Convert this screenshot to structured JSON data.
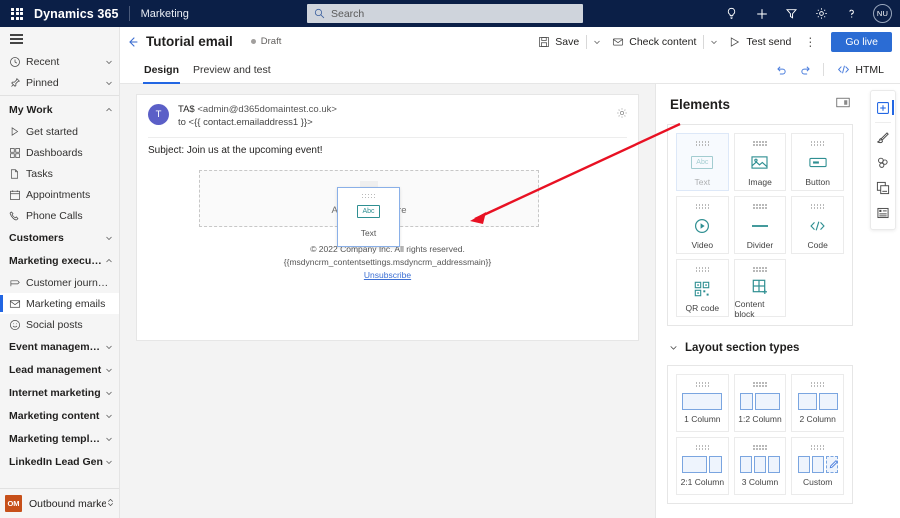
{
  "topnav": {
    "waffle_label": "app-launcher",
    "brand": "Dynamics 365",
    "app_name": "Marketing",
    "search_placeholder": "Search",
    "icons": [
      "lightbulb-icon",
      "plus-icon",
      "filter-icon",
      "gear-icon",
      "help-icon"
    ],
    "avatar_initials": "NU"
  },
  "sidebar": {
    "hamburger": "site-map-toggle",
    "items": [
      {
        "label": "Recent",
        "icon": "clock-icon",
        "type": "expandable",
        "chevron": "down"
      },
      {
        "label": "Pinned",
        "icon": "pin-icon",
        "type": "expandable",
        "chevron": "down"
      },
      {
        "label": "My Work",
        "icon": "",
        "type": "group",
        "chevron": "up"
      },
      {
        "label": "Get started",
        "icon": "play-icon",
        "type": "item"
      },
      {
        "label": "Dashboards",
        "icon": "dashboard-icon",
        "type": "item"
      },
      {
        "label": "Tasks",
        "icon": "task-icon",
        "type": "item"
      },
      {
        "label": "Appointments",
        "icon": "calendar-icon",
        "type": "item"
      },
      {
        "label": "Phone Calls",
        "icon": "phone-icon",
        "type": "item"
      },
      {
        "label": "Customers",
        "icon": "",
        "type": "group",
        "chevron": "down"
      },
      {
        "label": "Marketing execution",
        "icon": "",
        "type": "group",
        "chevron": "up"
      },
      {
        "label": "Customer journeys",
        "icon": "journey-icon",
        "type": "item"
      },
      {
        "label": "Marketing emails",
        "icon": "mail-icon",
        "type": "item",
        "selected": true
      },
      {
        "label": "Social posts",
        "icon": "social-icon",
        "type": "item"
      },
      {
        "label": "Event management",
        "icon": "",
        "type": "group",
        "chevron": "down"
      },
      {
        "label": "Lead management",
        "icon": "",
        "type": "group",
        "chevron": "down"
      },
      {
        "label": "Internet marketing",
        "icon": "",
        "type": "group",
        "chevron": "down"
      },
      {
        "label": "Marketing content",
        "icon": "",
        "type": "group",
        "chevron": "down"
      },
      {
        "label": "Marketing templates",
        "icon": "",
        "type": "group",
        "chevron": "down"
      },
      {
        "label": "LinkedIn Lead Gen",
        "icon": "",
        "type": "group",
        "chevron": "down"
      }
    ],
    "app_switcher": {
      "badge": "OM",
      "label": "Outbound market...",
      "icon": "updown-chevron-icon"
    }
  },
  "command_bar": {
    "back_icon": "back-arrow-icon",
    "record_title": "Tutorial email",
    "status": "Draft",
    "save": "Save",
    "check_content": "Check content",
    "test_send": "Test send",
    "overflow": "⋮",
    "go_live": "Go live"
  },
  "tabs": {
    "items": [
      {
        "label": "Design",
        "active": true
      },
      {
        "label": "Preview and test",
        "active": false
      }
    ],
    "undo_icon": "undo-icon",
    "redo_icon": "redo-icon",
    "html_label": "HTML",
    "html_icon": "code-icon"
  },
  "email": {
    "from_avatar": "T",
    "from_line": "TA$",
    "from_address": "<admin@d365domaintest.co.uk>",
    "to_line": "to <{{ contact.emailaddress1 }}>",
    "settings_icon": "gear-icon",
    "subject": "Subject: Join us at the upcoming event!",
    "dropzone_label": "Add element here",
    "dropzone_plus": "+",
    "drag_ghost": {
      "label": "Text",
      "icon": "Abc"
    },
    "footer_line1": "© 2022 Company Inc. All rights reserved.",
    "footer_line2": "{{msdyncrm_contentsettings.msdyncrm_addressmain}}",
    "footer_link": "Unsubscribe"
  },
  "elements_panel": {
    "title": "Elements",
    "pin_icon": "collapse-panel-icon",
    "elements": [
      {
        "label": "Text",
        "icon": "abc-icon",
        "dragging": true
      },
      {
        "label": "Image",
        "icon": "image-icon"
      },
      {
        "label": "Button",
        "icon": "button-icon"
      },
      {
        "label": "Video",
        "icon": "video-icon"
      },
      {
        "label": "Divider",
        "icon": "divider-icon"
      },
      {
        "label": "Code",
        "icon": "code-icon"
      },
      {
        "label": "QR code",
        "icon": "qr-code-icon"
      },
      {
        "label": "Content block",
        "icon": "content-block-icon"
      }
    ],
    "layout_section": {
      "title": "Layout section types",
      "chevron": "chevron-down-icon",
      "layouts": [
        {
          "label": "1 Column",
          "cols": [
            1
          ]
        },
        {
          "label": "1:2 Column",
          "cols": [
            1,
            2
          ]
        },
        {
          "label": "2 Column",
          "cols": [
            1,
            1
          ]
        },
        {
          "label": "2:1 Column",
          "cols": [
            2,
            1
          ]
        },
        {
          "label": "3 Column",
          "cols": [
            1,
            1,
            1
          ]
        },
        {
          "label": "Custom",
          "cols": [
            1,
            1,
            1
          ],
          "custom": true
        }
      ]
    }
  },
  "right_toolbar": {
    "tools": [
      {
        "name": "add-elements-icon",
        "active": true
      },
      {
        "name": "styles-brush-icon",
        "active": false
      },
      {
        "name": "themes-icon",
        "active": false
      },
      {
        "name": "content-blocks-icon",
        "active": false
      },
      {
        "name": "properties-icon",
        "active": false
      }
    ]
  },
  "colors": {
    "nav_bg": "#0b1f47",
    "accent": "#2266e3",
    "go_live": "#2b6cd4",
    "element_icon": "#2f8f92",
    "arrow": "#e81123",
    "app_badge": "#c7501a"
  }
}
